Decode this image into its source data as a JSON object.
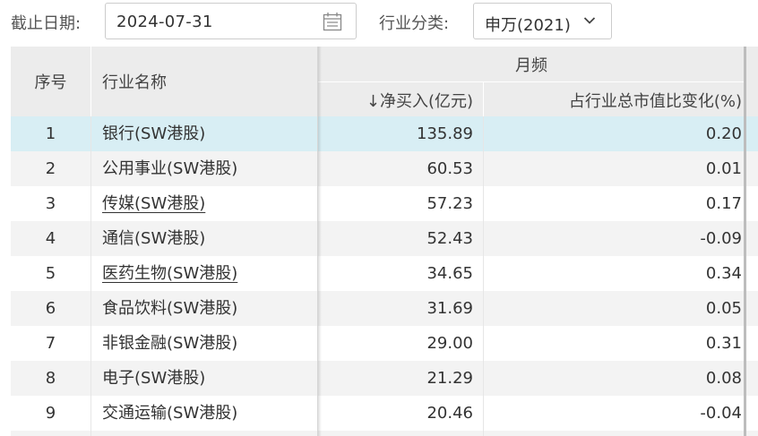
{
  "filters": {
    "date_label": "截止日期:",
    "date_value": "2024-07-31",
    "industry_label": "行业分类:",
    "industry_value": "申万(2021)"
  },
  "table": {
    "headers": {
      "index": "序号",
      "name": "行业名称",
      "group": "月频",
      "net_buy": "↓净买入(亿元)",
      "pct_change": "占行业总市值比变化(%)"
    },
    "rows": [
      {
        "index": "1",
        "name": "银行(SW港股)",
        "net_buy": "135.89",
        "pct": "0.20"
      },
      {
        "index": "2",
        "name": "公用事业(SW港股)",
        "net_buy": "60.53",
        "pct": "0.01"
      },
      {
        "index": "3",
        "name": "传媒(SW港股)",
        "net_buy": "57.23",
        "pct": "0.17"
      },
      {
        "index": "4",
        "name": "通信(SW港股)",
        "net_buy": "52.43",
        "pct": "-0.09"
      },
      {
        "index": "5",
        "name": "医药生物(SW港股)",
        "net_buy": "34.65",
        "pct": "0.34"
      },
      {
        "index": "6",
        "name": "食品饮料(SW港股)",
        "net_buy": "31.69",
        "pct": "0.05"
      },
      {
        "index": "7",
        "name": "非银金融(SW港股)",
        "net_buy": "29.00",
        "pct": "0.31"
      },
      {
        "index": "8",
        "name": "电子(SW港股)",
        "net_buy": "21.29",
        "pct": "0.08"
      },
      {
        "index": "9",
        "name": "交通运输(SW港股)",
        "net_buy": "20.46",
        "pct": "-0.04"
      }
    ]
  },
  "icons": {
    "date": "calendar-icon",
    "select": "chevron-down-icon"
  },
  "colors": {
    "header_bg": "#ececec",
    "row_highlight": "#d8eef4",
    "row_stripe": "#f3f3f3"
  }
}
